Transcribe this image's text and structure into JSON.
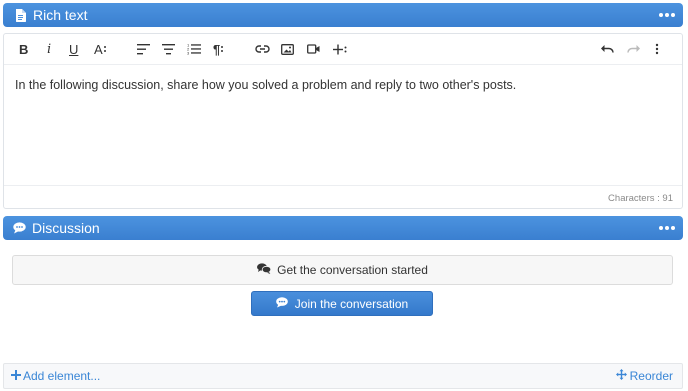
{
  "rich_text": {
    "title": "Rich text",
    "icon": "document-icon",
    "menu_icon": "more-horizontal-icon",
    "toolbar": {
      "bold": "B",
      "italic": "i",
      "underline": "U",
      "font_size": "A",
      "paragraph": "¶"
    },
    "content": "In the following discussion, share how you solved a problem and reply to two other's posts.",
    "character_count": "Characters : 91"
  },
  "discussion": {
    "title": "Discussion",
    "icon": "comment-icon",
    "menu_icon": "more-horizontal-icon",
    "start_label": "Get the conversation started",
    "join_label": "Join the conversation"
  },
  "footer": {
    "add_element_label": "Add element...",
    "reorder_label": "Reorder"
  },
  "colors": {
    "header_blue": "#3f86d7",
    "link_blue": "#3a86d6",
    "button_blue": "#3a7fd0"
  }
}
